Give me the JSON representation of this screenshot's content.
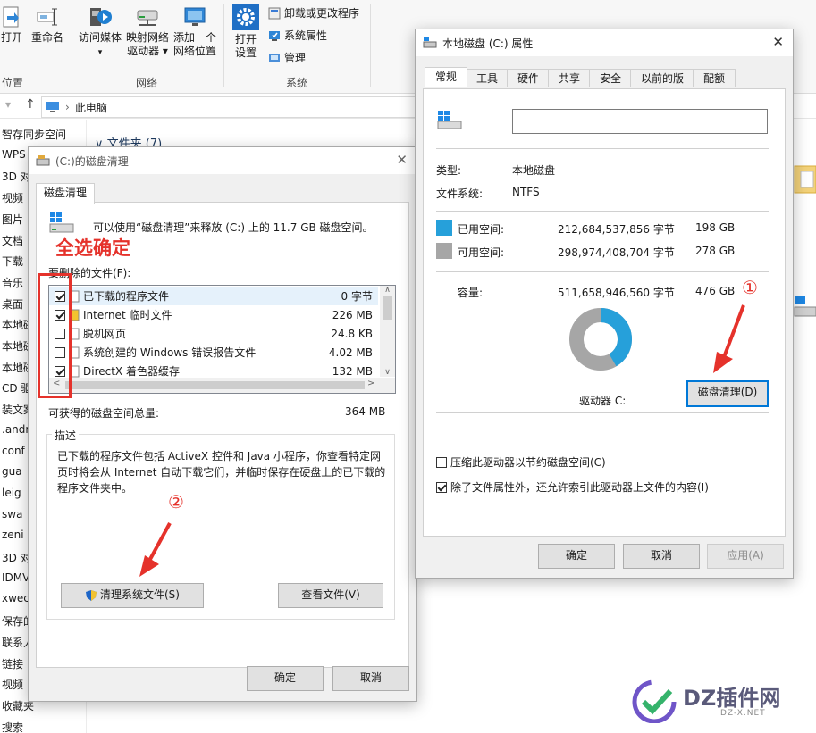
{
  "ribbon": {
    "open_label": "打开",
    "rename_label": "重命名",
    "location_group": "位置",
    "access_media_label": "访问媒体",
    "map_drive_line1": "映射网络",
    "map_drive_line2": "驱动器",
    "add_location_line1": "添加一个",
    "add_location_line2": "网络位置",
    "network_group": "网络",
    "open_settings_line1": "打开",
    "open_settings_line2": "设置",
    "uninstall_label": "卸载或更改程序",
    "system_props_label": "系统属性",
    "manage_label": "管理",
    "system_group": "系统"
  },
  "address": {
    "path": "此电脑"
  },
  "nav": {
    "items": [
      "智存同步空间",
      "WPS",
      "3D 对",
      "视频",
      "图片",
      "文档",
      "下载",
      "音乐",
      "桌面",
      "本地磁",
      "本地磁",
      "本地磁",
      "CD 驱",
      "装文案",
      ".andr",
      "conf",
      "gua",
      "leig",
      "swa",
      "zeni",
      "3D 对",
      "IDMV",
      "xwec",
      "保存的",
      "联系人",
      "链接",
      "视频",
      "收藏夹",
      "搜索"
    ]
  },
  "explorer": {
    "folders_header": "文件夹 (7)"
  },
  "cleanup": {
    "title": "(C:)的磁盘清理",
    "tab": "磁盘清理",
    "intro": "可以使用“磁盘清理”来释放  (C:) 上的 11.7 GB 磁盘空间。",
    "files_label": "要删除的文件(F):",
    "rows": [
      {
        "name": "已下载的程序文件",
        "size": "0 字节",
        "checked": true
      },
      {
        "name": "Internet 临时文件",
        "size": "226 MB",
        "checked": true
      },
      {
        "name": "脱机网页",
        "size": "24.8 KB",
        "checked": false
      },
      {
        "name": "系统创建的 Windows 错误报告文件",
        "size": "4.02 MB",
        "checked": false
      },
      {
        "name": "DirectX 着色器缓存",
        "size": "132 MB",
        "checked": true
      }
    ],
    "total_label": "可获得的磁盘空间总量:",
    "total_value": "364 MB",
    "desc_label": "描述",
    "desc_text": "已下载的程序文件包括 ActiveX 控件和 Java 小程序，你查看特定网页时将会从 Internet 自动下载它们，并临时保存在硬盘上的已下载的程序文件夹中。",
    "clean_system_btn": "清理系统文件(S)",
    "view_files_btn": "查看文件(V)",
    "ok_btn": "确定",
    "cancel_btn": "取消",
    "annotation_text": "全选确定",
    "annotation_step": "②"
  },
  "props": {
    "title": "本地磁盘 (C:) 属性",
    "tabs": [
      "常规",
      "工具",
      "硬件",
      "共享",
      "安全",
      "以前的版本",
      "配额"
    ],
    "type_label": "类型:",
    "type_value": "本地磁盘",
    "fs_label": "文件系统:",
    "fs_value": "NTFS",
    "used_label": "已用空间:",
    "used_bytes": "212,684,537,856 字节",
    "used_gb": "198 GB",
    "free_label": "可用空间:",
    "free_bytes": "298,974,408,704 字节",
    "free_gb": "278 GB",
    "capacity_label": "容量:",
    "capacity_bytes": "511,658,946,560 字节",
    "capacity_gb": "476 GB",
    "drive_label": "驱动器 C:",
    "cleanup_btn": "磁盘清理(D)",
    "compress_label": "压缩此驱动器以节约磁盘空间(C)",
    "index_label": "除了文件属性外，还允许索引此驱动器上文件的内容(I)",
    "ok_btn": "确定",
    "cancel_btn": "取消",
    "apply_btn": "应用(A)",
    "used_fraction": 0.4157,
    "used_color": "#26a0da",
    "free_color": "#a6a6a6",
    "annotation_step": "①"
  },
  "watermark": {
    "brand": "DZ插件网",
    "url": "DZ-X.NET"
  }
}
